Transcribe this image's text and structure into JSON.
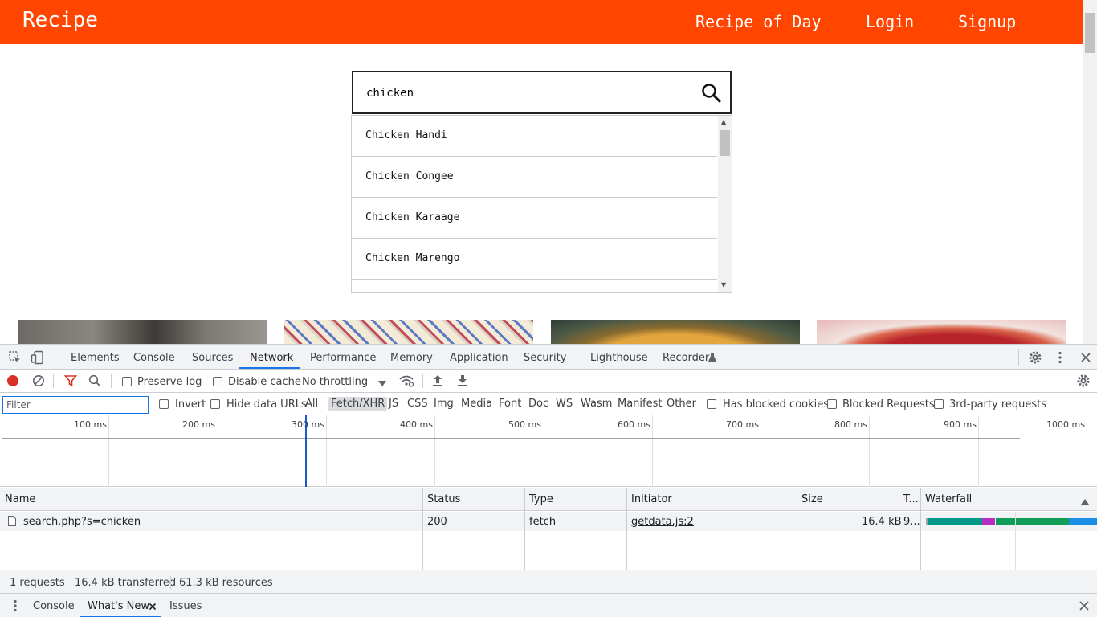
{
  "site": {
    "brand": "Recipe",
    "nav": {
      "recipe_of_day": "Recipe of Day",
      "login": "Login",
      "signup": "Signup"
    },
    "search": {
      "value": "chicken",
      "icon": "search-icon"
    },
    "suggestions": [
      "Chicken Handi",
      "Chicken Congee",
      "Chicken Karaage",
      "Chicken Marengo"
    ]
  },
  "devtools": {
    "tabs": [
      "Elements",
      "Console",
      "Sources",
      "Network",
      "Performance",
      "Memory",
      "Application",
      "Security",
      "Lighthouse",
      "Recorder"
    ],
    "active_tab": "Network",
    "toolbar": {
      "preserve_log": "Preserve log",
      "disable_cache": "Disable cache",
      "throttling": "No throttling"
    },
    "filter": {
      "placeholder": "Filter",
      "invert": "Invert",
      "hide_data_urls": "Hide data URLs",
      "types": [
        "All",
        "Fetch/XHR",
        "JS",
        "CSS",
        "Img",
        "Media",
        "Font",
        "Doc",
        "WS",
        "Wasm",
        "Manifest",
        "Other"
      ],
      "active_type": "Fetch/XHR",
      "has_blocked_cookies": "Has blocked cookies",
      "blocked_requests": "Blocked Requests",
      "third_party": "3rd-party requests"
    },
    "overview_ticks": [
      "100 ms",
      "200 ms",
      "300 ms",
      "400 ms",
      "500 ms",
      "600 ms",
      "700 ms",
      "800 ms",
      "900 ms",
      "1000 ms"
    ],
    "table": {
      "headers": {
        "name": "Name",
        "status": "Status",
        "type": "Type",
        "initiator": "Initiator",
        "size": "Size",
        "time": "T...",
        "waterfall": "Waterfall"
      },
      "rows": [
        {
          "name": "search.php?s=chicken",
          "status": "200",
          "type": "fetch",
          "initiator": "getdata.js:2",
          "size": "16.4 kB",
          "time": "9..."
        }
      ]
    },
    "status": {
      "requests": "1 requests",
      "transferred": "16.4 kB transferred",
      "resources": "61.3 kB resources"
    },
    "drawer": {
      "console": "Console",
      "whats_new": "What's New",
      "issues": "Issues"
    },
    "colors": {
      "accent": "#1a73e8",
      "record": "#d93025",
      "brand": "#ff4500"
    }
  }
}
